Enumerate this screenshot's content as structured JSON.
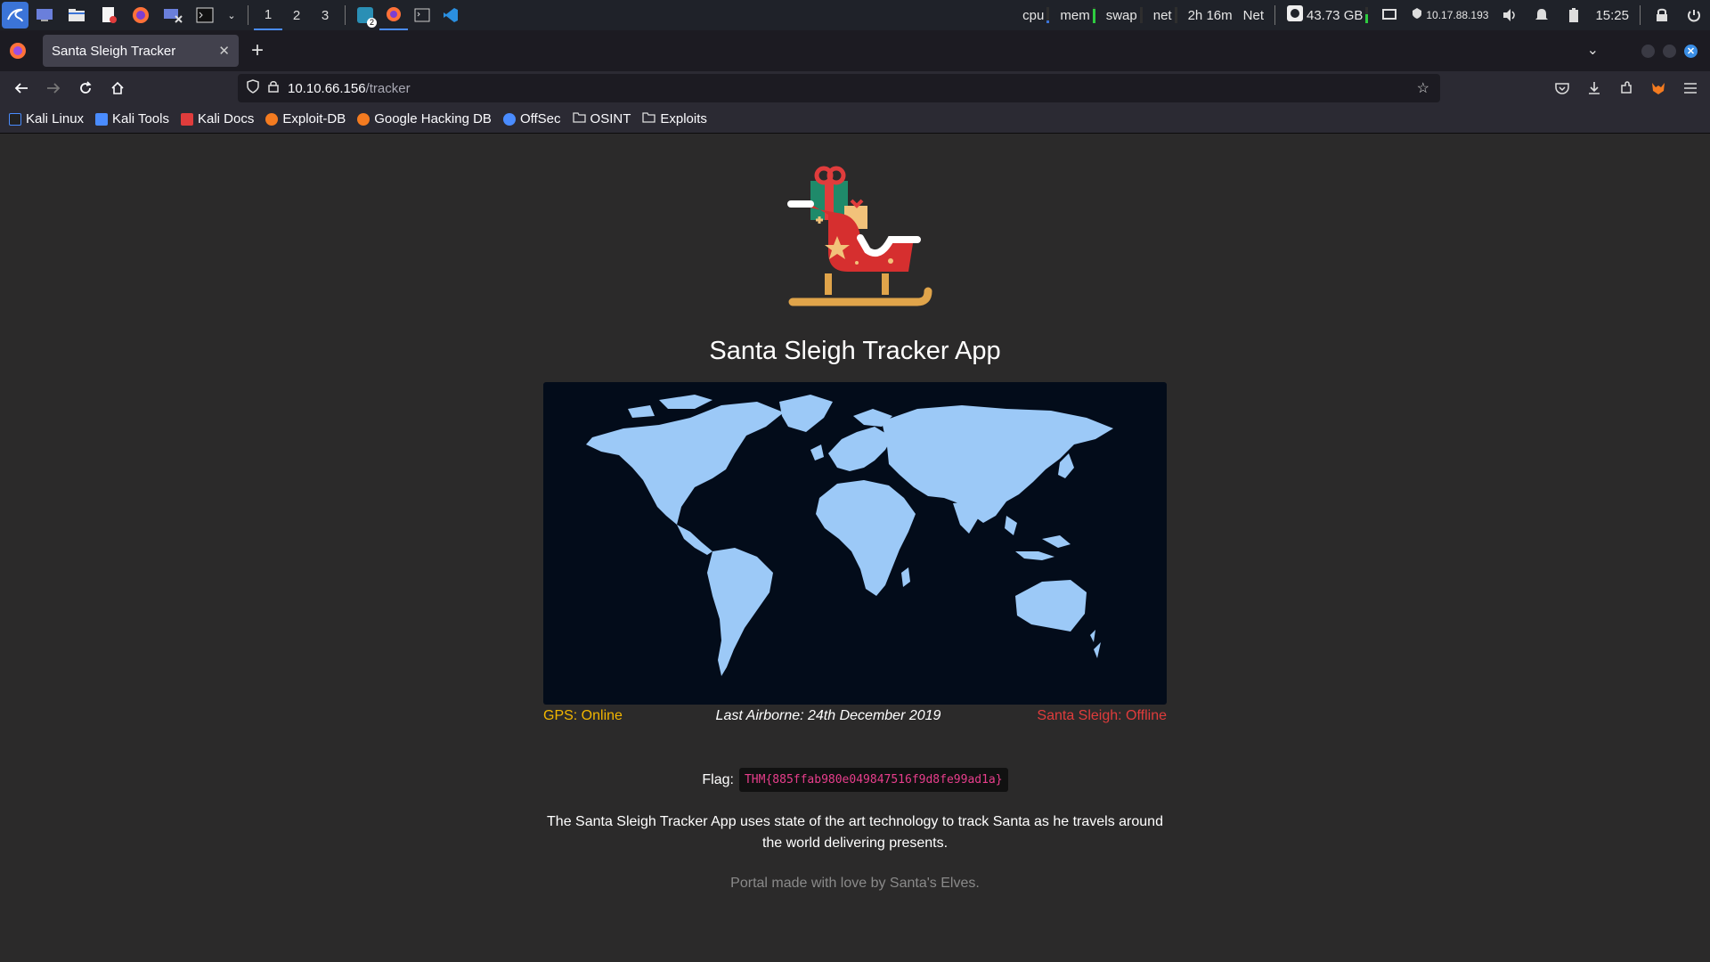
{
  "system_panel": {
    "workspaces": [
      "1",
      "2",
      "3"
    ],
    "monitors": {
      "cpu": "cpu",
      "mem": "mem",
      "swap": "swap",
      "net": "net",
      "uptime": "2h 16m",
      "net2": "Net"
    },
    "disk": "43.73 GB",
    "ip": "10.17.88.193",
    "time": "15:25",
    "notify_badge": "2"
  },
  "browser": {
    "tab_title": "Santa Sleigh Tracker",
    "url_host": "10.10.66.156",
    "url_path": "/tracker",
    "bookmarks": [
      {
        "label": "Kali Linux",
        "color": "#4a8cff"
      },
      {
        "label": "Kali Tools",
        "color": "#4a8cff"
      },
      {
        "label": "Kali Docs",
        "color": "#e03c3c"
      },
      {
        "label": "Exploit-DB",
        "color": "#f47b20"
      },
      {
        "label": "Google Hacking DB",
        "color": "#f47b20"
      },
      {
        "label": "OffSec",
        "color": "#4a8cff"
      },
      {
        "label": "OSINT",
        "color": "#dddddd"
      },
      {
        "label": "Exploits",
        "color": "#dddddd"
      }
    ]
  },
  "page": {
    "title": "Santa Sleigh Tracker App",
    "gps_status": "GPS: Online",
    "last_airborne": "Last Airborne: 24th December 2019",
    "sleigh_status": "Santa Sleigh: Offline",
    "flag_label": "Flag:",
    "flag_value": "THM{885ffab980e049847516f9d8fe99ad1a}",
    "description": "The Santa Sleigh Tracker App uses state of the art technology to track Santa as he travels around the world delivering presents.",
    "footer": "Portal made with love by Santa's Elves."
  },
  "colors": {
    "gps_online": "#f2b600",
    "sleigh_offline": "#e03c3c",
    "map_bg": "#030c1a",
    "map_land": "#9cc9f7"
  }
}
